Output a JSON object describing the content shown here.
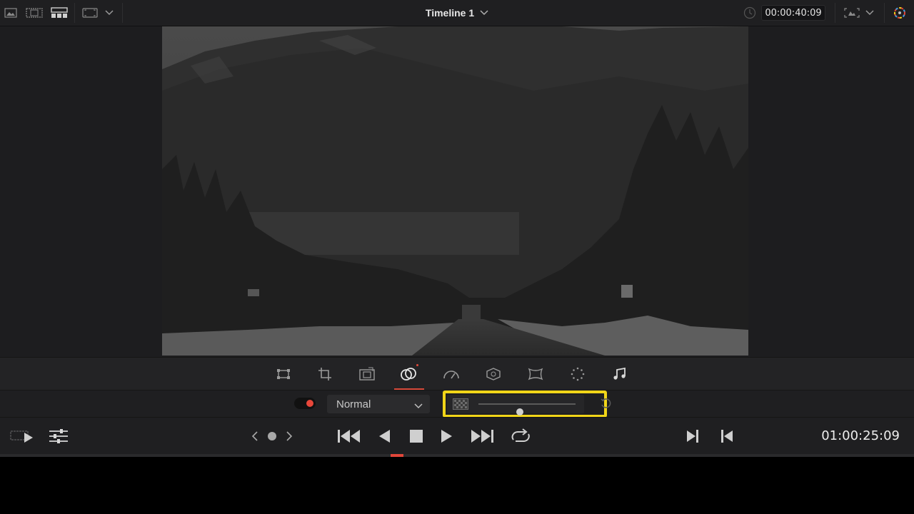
{
  "topbar": {
    "title": "Timeline 1",
    "timecode": "00:00:40:09",
    "icons": [
      "media-pool-icon",
      "clip-view-icon",
      "layout-icon",
      "viewer-mode-icon",
      "chevron-down-icon",
      "timeline-chevron-icon",
      "timecode-clock-icon",
      "transform-overlay-icon",
      "chevron-down-icon",
      "color-wheel-icon"
    ]
  },
  "toolstrip": {
    "tools": [
      "transform-icon",
      "crop-icon",
      "dynamic-zoom-icon",
      "composite-icon",
      "speed-change-icon",
      "stabilization-icon",
      "lens-correction-icon",
      "retime-icon",
      "audio-icon"
    ],
    "active_tool": "composite-icon"
  },
  "composite": {
    "enabled": true,
    "mode": "Normal",
    "opacity_fraction": 0.43,
    "highlight_color": "#f1d518"
  },
  "transport": {
    "timecode": "01:00:25:09",
    "buttons": [
      "prev-keyframe-icon",
      "keyframe-icon",
      "next-keyframe-icon",
      "go-to-start-icon",
      "play-reverse-icon",
      "stop-icon",
      "play-icon",
      "go-to-end-icon",
      "loop-icon",
      "next-edit-icon",
      "previous-edit-icon"
    ]
  },
  "colors": {
    "accent": "#e8473a",
    "highlight": "#f1d518",
    "background": "#1f1f21"
  }
}
